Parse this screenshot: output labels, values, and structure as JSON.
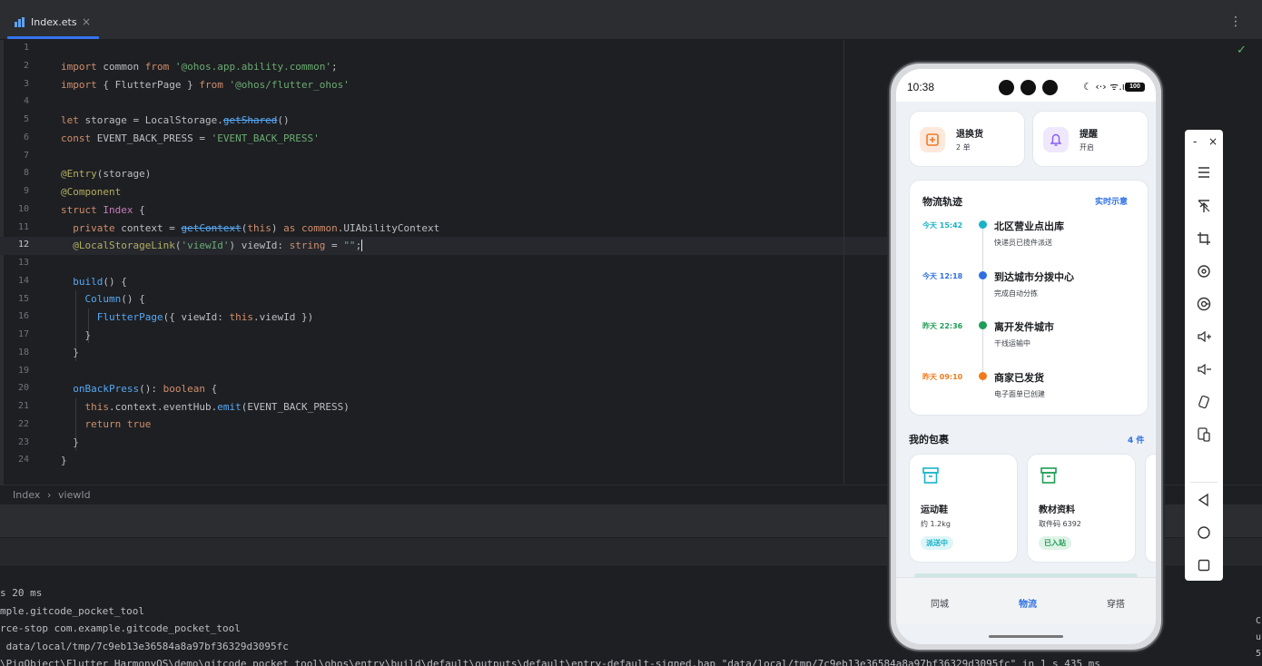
{
  "tab": {
    "filename": "Index.ets",
    "close": "×",
    "menu": "⋮"
  },
  "editor": {
    "check": "✓",
    "line_numbers": [
      "1",
      "2",
      "3",
      "4",
      "5",
      "6",
      "7",
      "8",
      "9",
      "10",
      "11",
      "12",
      "13",
      "14",
      "15",
      "16",
      "17",
      "18",
      "19",
      "20",
      "21",
      "22",
      "23",
      "24"
    ],
    "current_line": "12"
  },
  "breadcrumb": {
    "items": [
      "Index",
      "viewId"
    ],
    "sep": "›"
  },
  "console": {
    "lines": [
      "s 20 ms",
      "mple.gitcode_pocket_tool",
      "rce-stop com.example.gitcode_pocket_tool",
      " data/local/tmp/7c9eb13e36584a8a97bf36329d3095fc",
      "\\PigObject\\Flutter_HarmonyOS\\demo\\gitcode_pocket_tool\\ohos\\entry\\build\\default\\outputs\\default\\entry-default-signed.hap \"data/local/tmp/7c9eb13e36584a8a97bf36329d3095fc\" in 1 s 435 ms"
    ],
    "right_chars": [
      "C",
      "u",
      "5"
    ]
  },
  "phone": {
    "status": {
      "time": "10:38",
      "icons": "☾ ‹·› ᯤ.ıl",
      "battery": "100"
    },
    "cards": [
      {
        "title": "退换货",
        "sub": "2 单",
        "icon": "return-icon",
        "color": "#f07a2a"
      },
      {
        "title": "提醒",
        "sub": "开启",
        "icon": "bell-icon",
        "color": "#8a5cf0"
      }
    ],
    "timeline": {
      "title": "物流轨迹",
      "link": "实时示意",
      "events": [
        {
          "time": "今天 15:42",
          "title": "北区营业点出库",
          "sub": "快递员已揽件派送",
          "color": "#19b3c7"
        },
        {
          "time": "今天 12:18",
          "title": "到达城市分拨中心",
          "sub": "完成自动分拣",
          "color": "#2f6fe4"
        },
        {
          "time": "昨天 22:36",
          "title": "离开发件城市",
          "sub": "干线运输中",
          "color": "#1f9d55"
        },
        {
          "time": "昨天 09:10",
          "title": "商家已发货",
          "sub": "电子面单已创建",
          "color": "#f07a1a"
        }
      ]
    },
    "packages": {
      "title": "我的包裹",
      "count": "4 件",
      "items": [
        {
          "name": "运动鞋",
          "detail": "约 1.2kg",
          "badge": "派送中",
          "color": "#19b3c7",
          "badge_bg": "#dff5f8"
        },
        {
          "name": "教材资料",
          "detail": "取件码 6392",
          "badge": "已入站",
          "color": "#1f9d55",
          "badge_bg": "#e0f3e7"
        }
      ]
    },
    "nav": [
      "同城",
      "物流",
      "穿搭"
    ],
    "nav_active": "物流"
  },
  "side_toolbar": {
    "minimize": "-",
    "close": "×",
    "icons": [
      "menu-icon",
      "pin-top-icon",
      "crop-icon",
      "rotate-icon",
      "screenshot-icon",
      "volume-up-icon",
      "volume-down-icon",
      "rotate-screen-icon",
      "multi-device-icon",
      "back-icon",
      "home-icon",
      "recent-apps-icon"
    ]
  }
}
